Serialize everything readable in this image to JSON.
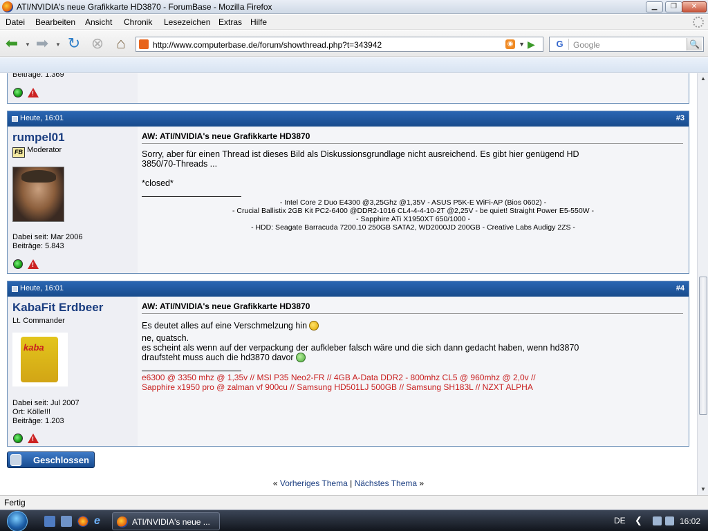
{
  "window": {
    "title": "ATI/NVIDIA's neue Grafikkarte HD3870 - ForumBase - Mozilla Firefox"
  },
  "menu": [
    "Datei",
    "Bearbeiten",
    "Ansicht",
    "Chronik",
    "Lesezeichen",
    "Extras",
    "Hilfe"
  ],
  "nav": {
    "url": "http://www.computerbase.de/forum/showthread.php?t=343942",
    "search_placeholder": "Google"
  },
  "prev_post": {
    "stat_partial": "Beiträge: 1.369"
  },
  "posts": [
    {
      "date": "Heute, 16:01",
      "number": "#3",
      "username": "rumpel01",
      "rank": "Moderator",
      "rank_badge": "FB",
      "joined": "Dabei seit: Mar 2006",
      "posts": "Beiträge: 5.843",
      "title": "AW: ATI/NVIDIA's neue Grafikkarte HD3870",
      "body_1": "Sorry, aber für einen Thread ist dieses Bild als Diskussionsgrundlage nicht ausreichend. Es gibt hier genügend HD",
      "body_2": "3850/70-Threads ...",
      "body_3": "*closed*",
      "sig": [
        "- Intel Core 2 Duo E4300 @3,25Ghz @1,35V - ASUS P5K-E WiFi-AP (Bios 0602) -",
        "- Crucial Ballistix 2GB Kit PC2-6400 @DDR2-1016 CL4-4-4-10-2T @2,25V - be quiet! Straight Power E5-550W -",
        "- Sapphire ATi X1950XT 650/1000 -",
        "- HDD: Seagate Barracuda 7200.10 250GB SATA2, WD2000JD 200GB - Creative Labs Audigy 2ZS -"
      ]
    },
    {
      "date": "Heute, 16:01",
      "number": "#4",
      "username": "KabaFit Erdbeer",
      "rank": "Lt. Commander",
      "avatar_text": "kaba",
      "joined": "Dabei seit: Jul 2007",
      "location": "Ort: Kölle!!!",
      "posts": "Beiträge: 1.203",
      "title": "AW: ATI/NVIDIA's neue Grafikkarte HD3870",
      "body_1": "Es deutet alles auf eine Verschmelzung hin",
      "body_2": "ne, quatsch.",
      "body_3": "es scheint als wenn auf der verpackung der aufkleber falsch wäre und die sich dann gedacht haben, wenn hd3870",
      "body_4": "draufsteht muss auch die hd3870 davor",
      "sig": [
        "e6300 @ 3350 mhz @ 1,35v // MSI P35 Neo2-FR // 4GB A-Data DDR2 - 800mhz CL5 @ 960mhz @ 2,0v //",
        "Sapphire x1950 pro @ zalman vf 900cu // Samsung HD501LJ 500GB // Samsung SH183L // NZXT ALPHA"
      ]
    }
  ],
  "closed_button": "Geschlossen",
  "thread_nav": {
    "prev_arrow": "«",
    "prev": "Vorheriges Thema",
    "sep": "|",
    "next": "Nächstes Thema",
    "next_arrow": "»"
  },
  "status": "Fertig",
  "taskbar": {
    "task_label": "ATI/NVIDIA's neue ...",
    "lang": "DE",
    "clock": "16:02"
  }
}
